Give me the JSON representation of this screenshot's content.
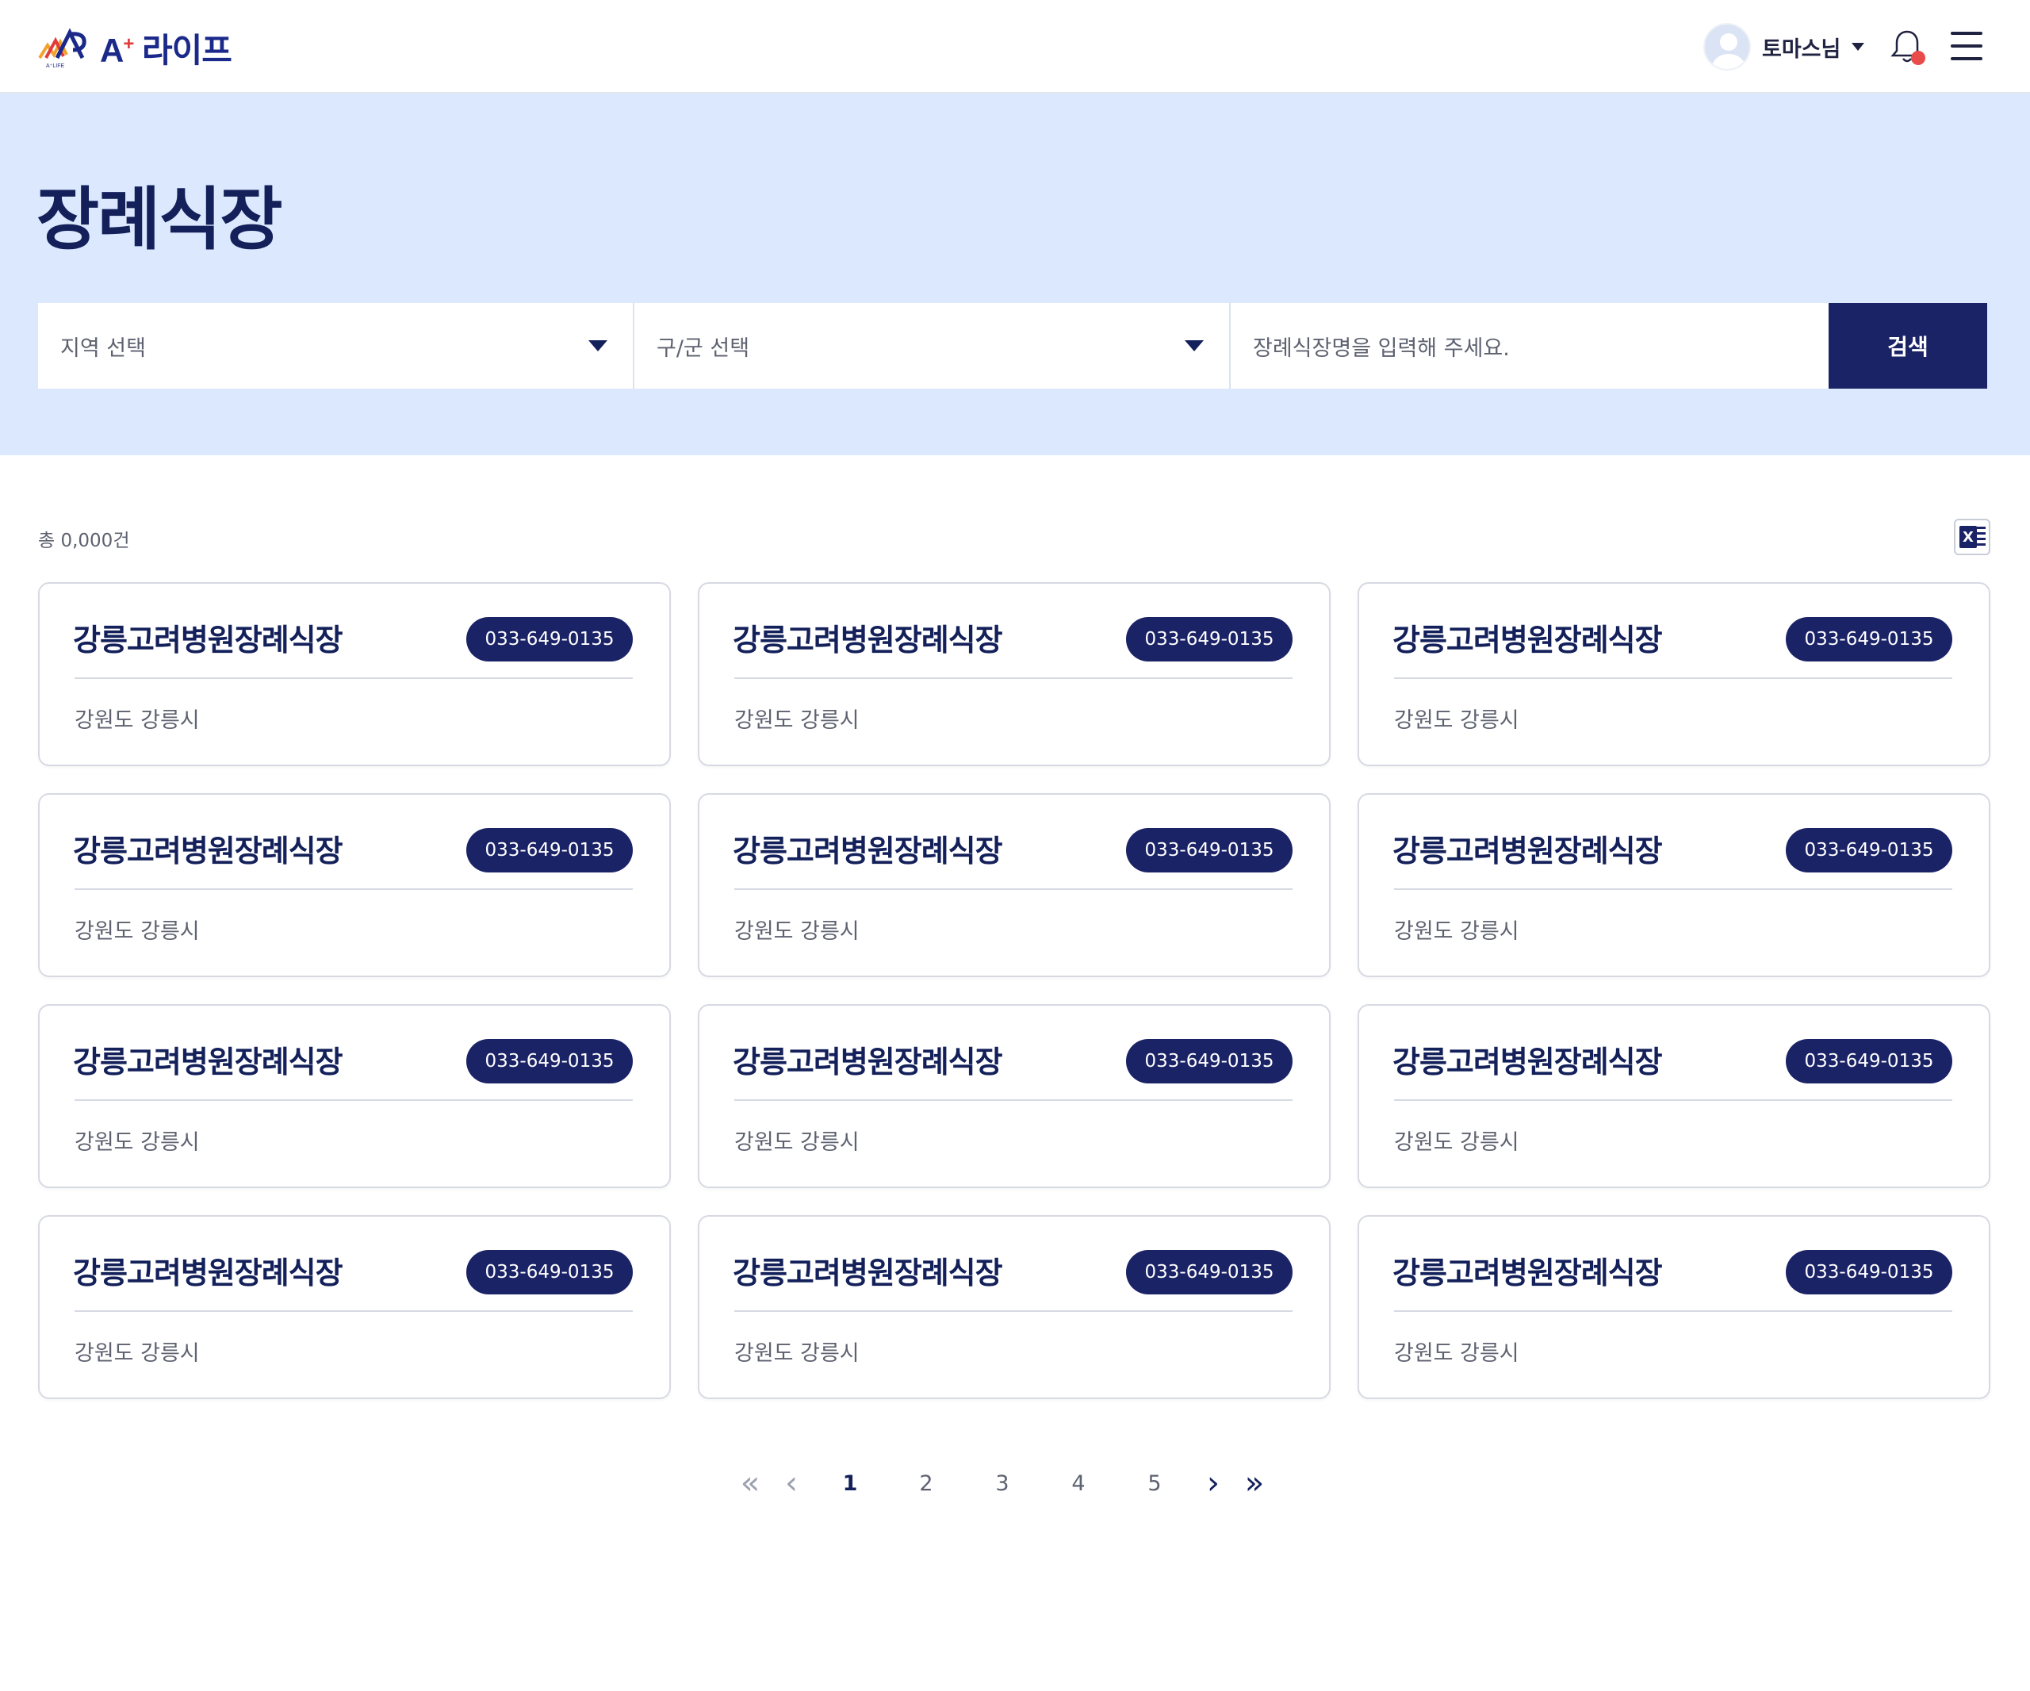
{
  "header": {
    "logo_text": "A",
    "logo_plus": "+",
    "logo_suffix": "라이프",
    "logo_sub": "A⁺LIFE",
    "user_name": "토마스님"
  },
  "hero": {
    "title": "장례식장",
    "region_select": "지역 선택",
    "district_select": "구/군 선택",
    "search_placeholder": "장례식장명을 입력해 주세요.",
    "search_button": "검색"
  },
  "list": {
    "count": "총 0,000건",
    "excel_icon": "excel-download-icon",
    "cards": [
      {
        "name": "강릉고려병원장례식장",
        "phone": "033-649-0135",
        "address": "강원도 강릉시"
      },
      {
        "name": "강릉고려병원장례식장",
        "phone": "033-649-0135",
        "address": "강원도 강릉시"
      },
      {
        "name": "강릉고려병원장례식장",
        "phone": "033-649-0135",
        "address": "강원도 강릉시"
      },
      {
        "name": "강릉고려병원장례식장",
        "phone": "033-649-0135",
        "address": "강원도 강릉시"
      },
      {
        "name": "강릉고려병원장례식장",
        "phone": "033-649-0135",
        "address": "강원도 강릉시"
      },
      {
        "name": "강릉고려병원장례식장",
        "phone": "033-649-0135",
        "address": "강원도 강릉시"
      },
      {
        "name": "강릉고려병원장례식장",
        "phone": "033-649-0135",
        "address": "강원도 강릉시"
      },
      {
        "name": "강릉고려병원장례식장",
        "phone": "033-649-0135",
        "address": "강원도 강릉시"
      },
      {
        "name": "강릉고려병원장례식장",
        "phone": "033-649-0135",
        "address": "강원도 강릉시"
      },
      {
        "name": "강릉고려병원장례식장",
        "phone": "033-649-0135",
        "address": "강원도 강릉시"
      },
      {
        "name": "강릉고려병원장례식장",
        "phone": "033-649-0135",
        "address": "강원도 강릉시"
      },
      {
        "name": "강릉고려병원장례식장",
        "phone": "033-649-0135",
        "address": "강원도 강릉시"
      }
    ]
  },
  "pagination": {
    "pages": [
      "1",
      "2",
      "3",
      "4",
      "5"
    ],
    "current": "1",
    "first": "«",
    "prev": "‹",
    "next": "›",
    "last": "»"
  },
  "colors": {
    "brand_navy": "#1b2367",
    "hero_bg": "#dbe8fd",
    "badge_red": "#e94b4b"
  }
}
